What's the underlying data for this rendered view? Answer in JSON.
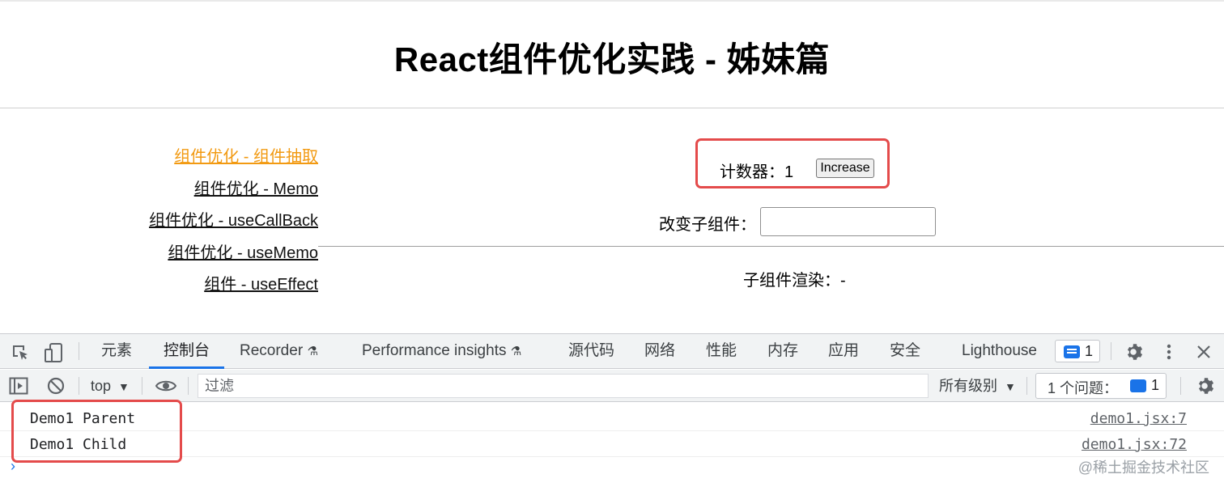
{
  "page": {
    "title": "React组件优化实践 - 姊妹篇"
  },
  "nav": {
    "items": [
      {
        "label": "组件优化 - 组件抽取",
        "active": true
      },
      {
        "label": "组件优化 - Memo"
      },
      {
        "label": "组件优化 - useCallBack"
      },
      {
        "label": "组件优化 - useMemo"
      },
      {
        "label": "组件 - useEffect"
      }
    ]
  },
  "demo": {
    "counter_label": "计数器：1",
    "increase_button": "Increase",
    "change_label": "改变子组件：",
    "change_input_value": "",
    "child_render": "子组件渲染：-"
  },
  "devtools": {
    "tabs": [
      "元素",
      "控制台",
      "Recorder",
      "Performance insights",
      "源代码",
      "网络",
      "性能",
      "内存",
      "应用",
      "安全",
      "Lighthouse"
    ],
    "active_tab": "控制台",
    "message_count": "1",
    "context": "top",
    "filter_placeholder": "过滤",
    "levels": "所有级别",
    "issues_label": "1 个问题：",
    "issues_count": "1"
  },
  "console": {
    "logs": [
      {
        "message": "Demo1 Parent",
        "source": "demo1.jsx:7"
      },
      {
        "message": "Demo1 Child",
        "source": "demo1.jsx:72"
      }
    ],
    "prompt": "›"
  },
  "watermark": "@稀土掘金技术社区",
  "colors": {
    "active_link": "#f29a12",
    "highlight_box": "#e44b4b",
    "devtools_accent": "#1a73e8"
  }
}
